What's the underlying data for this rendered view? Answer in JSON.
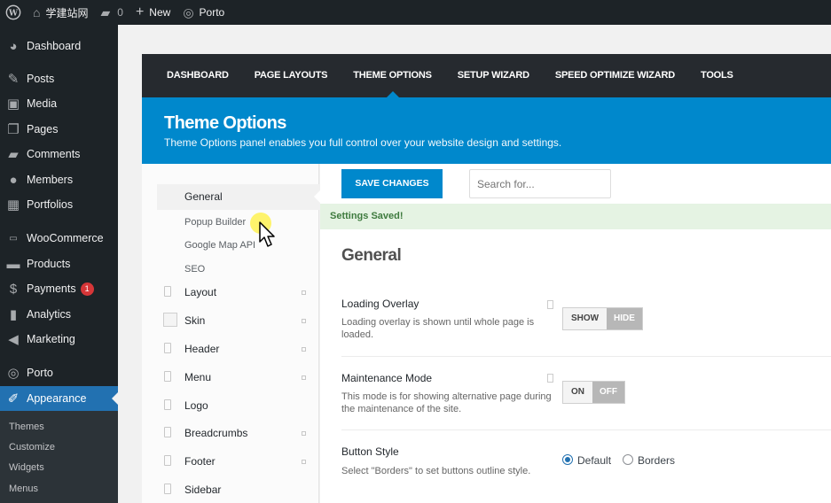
{
  "adminbar": {
    "site_name": "学建站网",
    "comments_count": "0",
    "new_label": "New",
    "porto_label": "Porto"
  },
  "sidebar": {
    "items": [
      {
        "label": "Dashboard",
        "icon": "dashboard-icon"
      },
      {
        "label": "Posts",
        "icon": "pin-icon"
      },
      {
        "label": "Media",
        "icon": "media-icon"
      },
      {
        "label": "Pages",
        "icon": "pages-icon"
      },
      {
        "label": "Comments",
        "icon": "comments-icon"
      },
      {
        "label": "Members",
        "icon": "user-icon"
      },
      {
        "label": "Portfolios",
        "icon": "portfolio-icon"
      },
      {
        "label": "WooCommerce",
        "icon": "woo-icon"
      },
      {
        "label": "Products",
        "icon": "archive-icon"
      },
      {
        "label": "Payments",
        "icon": "dollar-icon",
        "badge": "1"
      },
      {
        "label": "Analytics",
        "icon": "chart-icon"
      },
      {
        "label": "Marketing",
        "icon": "megaphone-icon"
      },
      {
        "label": "Porto",
        "icon": "porto-icon"
      },
      {
        "label": "Appearance",
        "icon": "brush-icon"
      }
    ],
    "submenu": [
      "Themes",
      "Customize",
      "Widgets",
      "Menus"
    ]
  },
  "porto": {
    "nav": [
      "DASHBOARD",
      "PAGE LAYOUTS",
      "THEME OPTIONS",
      "SETUP WIZARD",
      "SPEED OPTIMIZE WIZARD",
      "TOOLS"
    ],
    "header_title": "Theme Options",
    "header_desc": "Theme Options panel enables you full control over your website design and settings.",
    "side": {
      "general": "General",
      "sub": [
        "Popup Builder",
        "Google Map API",
        "SEO"
      ],
      "rows": [
        "Layout",
        "Skin",
        "Header",
        "Menu",
        "Logo",
        "Breadcrumbs",
        "Footer",
        "Sidebar"
      ]
    },
    "save_label": "SAVE CHANGES",
    "search_placeholder": "Search for...",
    "notice": "Settings Saved!",
    "section_title": "General",
    "fields": {
      "loading_title": "Loading Overlay",
      "loading_desc": "Loading overlay is shown until whole page is loaded.",
      "loading_show": "SHOW",
      "loading_hide": "HIDE",
      "maint_title": "Maintenance Mode",
      "maint_desc": "This mode is for showing alternative page during the maintenance of the site.",
      "maint_on": "ON",
      "maint_off": "OFF",
      "button_title": "Button Style",
      "button_desc": "Select \"Borders\" to set buttons outline style.",
      "button_default": "Default",
      "button_borders": "Borders"
    }
  },
  "colors": {
    "accent": "#0088cc",
    "wp_blue": "#2271b1",
    "admin_dark": "#1d2327"
  }
}
